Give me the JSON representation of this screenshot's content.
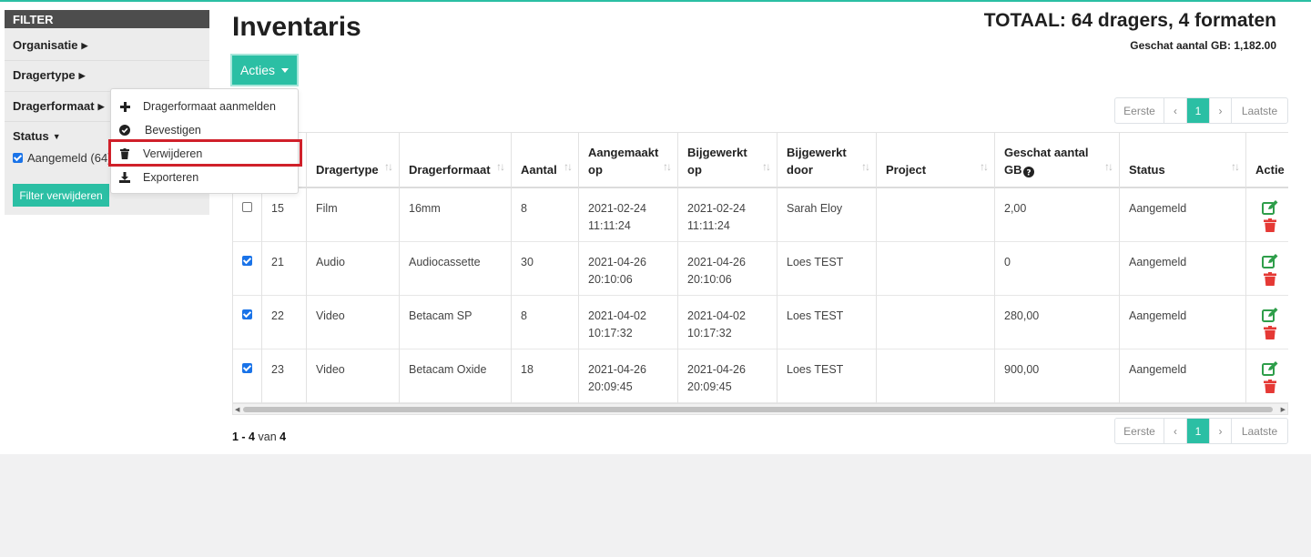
{
  "filter": {
    "header": "FILTER",
    "sections": [
      {
        "label": "Organisatie"
      },
      {
        "label": "Dragertype"
      },
      {
        "label": "Dragerformaat"
      },
      {
        "label": "Status"
      }
    ],
    "status_option": "Aangemeld (64)",
    "clear_button": "Filter verwijderen"
  },
  "page": {
    "title": "Inventaris",
    "total": "TOTAAL: 64 dragers, 4 formaten",
    "estimated_gb": "Geschat aantal GB: 1,182.00"
  },
  "actions": {
    "button": "Acties",
    "menu": [
      {
        "label": "Dragerformaat aanmelden",
        "icon": "plus-icon"
      },
      {
        "label": "Bevestigen",
        "icon": "check-circle-icon"
      },
      {
        "label": "Verwijderen",
        "icon": "trash-icon"
      },
      {
        "label": "Exporteren",
        "icon": "download-icon"
      }
    ]
  },
  "pagination": {
    "first": "Eerste",
    "prev": "‹",
    "page": "1",
    "next": "›",
    "last": "Laatste"
  },
  "table": {
    "columns": [
      {
        "label": ""
      },
      {
        "label": ""
      },
      {
        "label": "Dragertype"
      },
      {
        "label": "Dragerformaat"
      },
      {
        "label": "Aantal"
      },
      {
        "label": "Aangemaakt op"
      },
      {
        "label": "Bijgewerkt op"
      },
      {
        "label": "Bijgewerkt door"
      },
      {
        "label": "Project"
      },
      {
        "label": "Geschat aantal GB"
      },
      {
        "label": "Status"
      },
      {
        "label": "Actie"
      }
    ],
    "rows": [
      {
        "checked": false,
        "id": "15",
        "type": "Film",
        "format": "16mm",
        "amount": "8",
        "created": "2021-02-24 11:11:24",
        "updated": "2021-02-24 11:11:24",
        "updated_by": "Sarah Eloy",
        "project": "",
        "gb": "2,00",
        "status": "Aangemeld"
      },
      {
        "checked": true,
        "id": "21",
        "type": "Audio",
        "format": "Audiocassette",
        "amount": "30",
        "created": "2021-04-26 20:10:06",
        "updated": "2021-04-26 20:10:06",
        "updated_by": "Loes TEST",
        "project": "",
        "gb": "0",
        "status": "Aangemeld"
      },
      {
        "checked": true,
        "id": "22",
        "type": "Video",
        "format": "Betacam SP",
        "amount": "8",
        "created": "2021-04-02 10:17:32",
        "updated": "2021-04-02 10:17:32",
        "updated_by": "Loes TEST",
        "project": "",
        "gb": "280,00",
        "status": "Aangemeld"
      },
      {
        "checked": true,
        "id": "23",
        "type": "Video",
        "format": "Betacam Oxide",
        "amount": "18",
        "created": "2021-04-26 20:09:45",
        "updated": "2021-04-26 20:09:45",
        "updated_by": "Loes TEST",
        "project": "",
        "gb": "900,00",
        "status": "Aangemeld"
      }
    ]
  },
  "footer": {
    "range": "1 - 4",
    "of": "van",
    "total": "4"
  },
  "colors": {
    "accent": "#2bbfa4",
    "danger": "#e53935",
    "highlight": "#d0202a",
    "filter_header": "#4d4d4d"
  }
}
